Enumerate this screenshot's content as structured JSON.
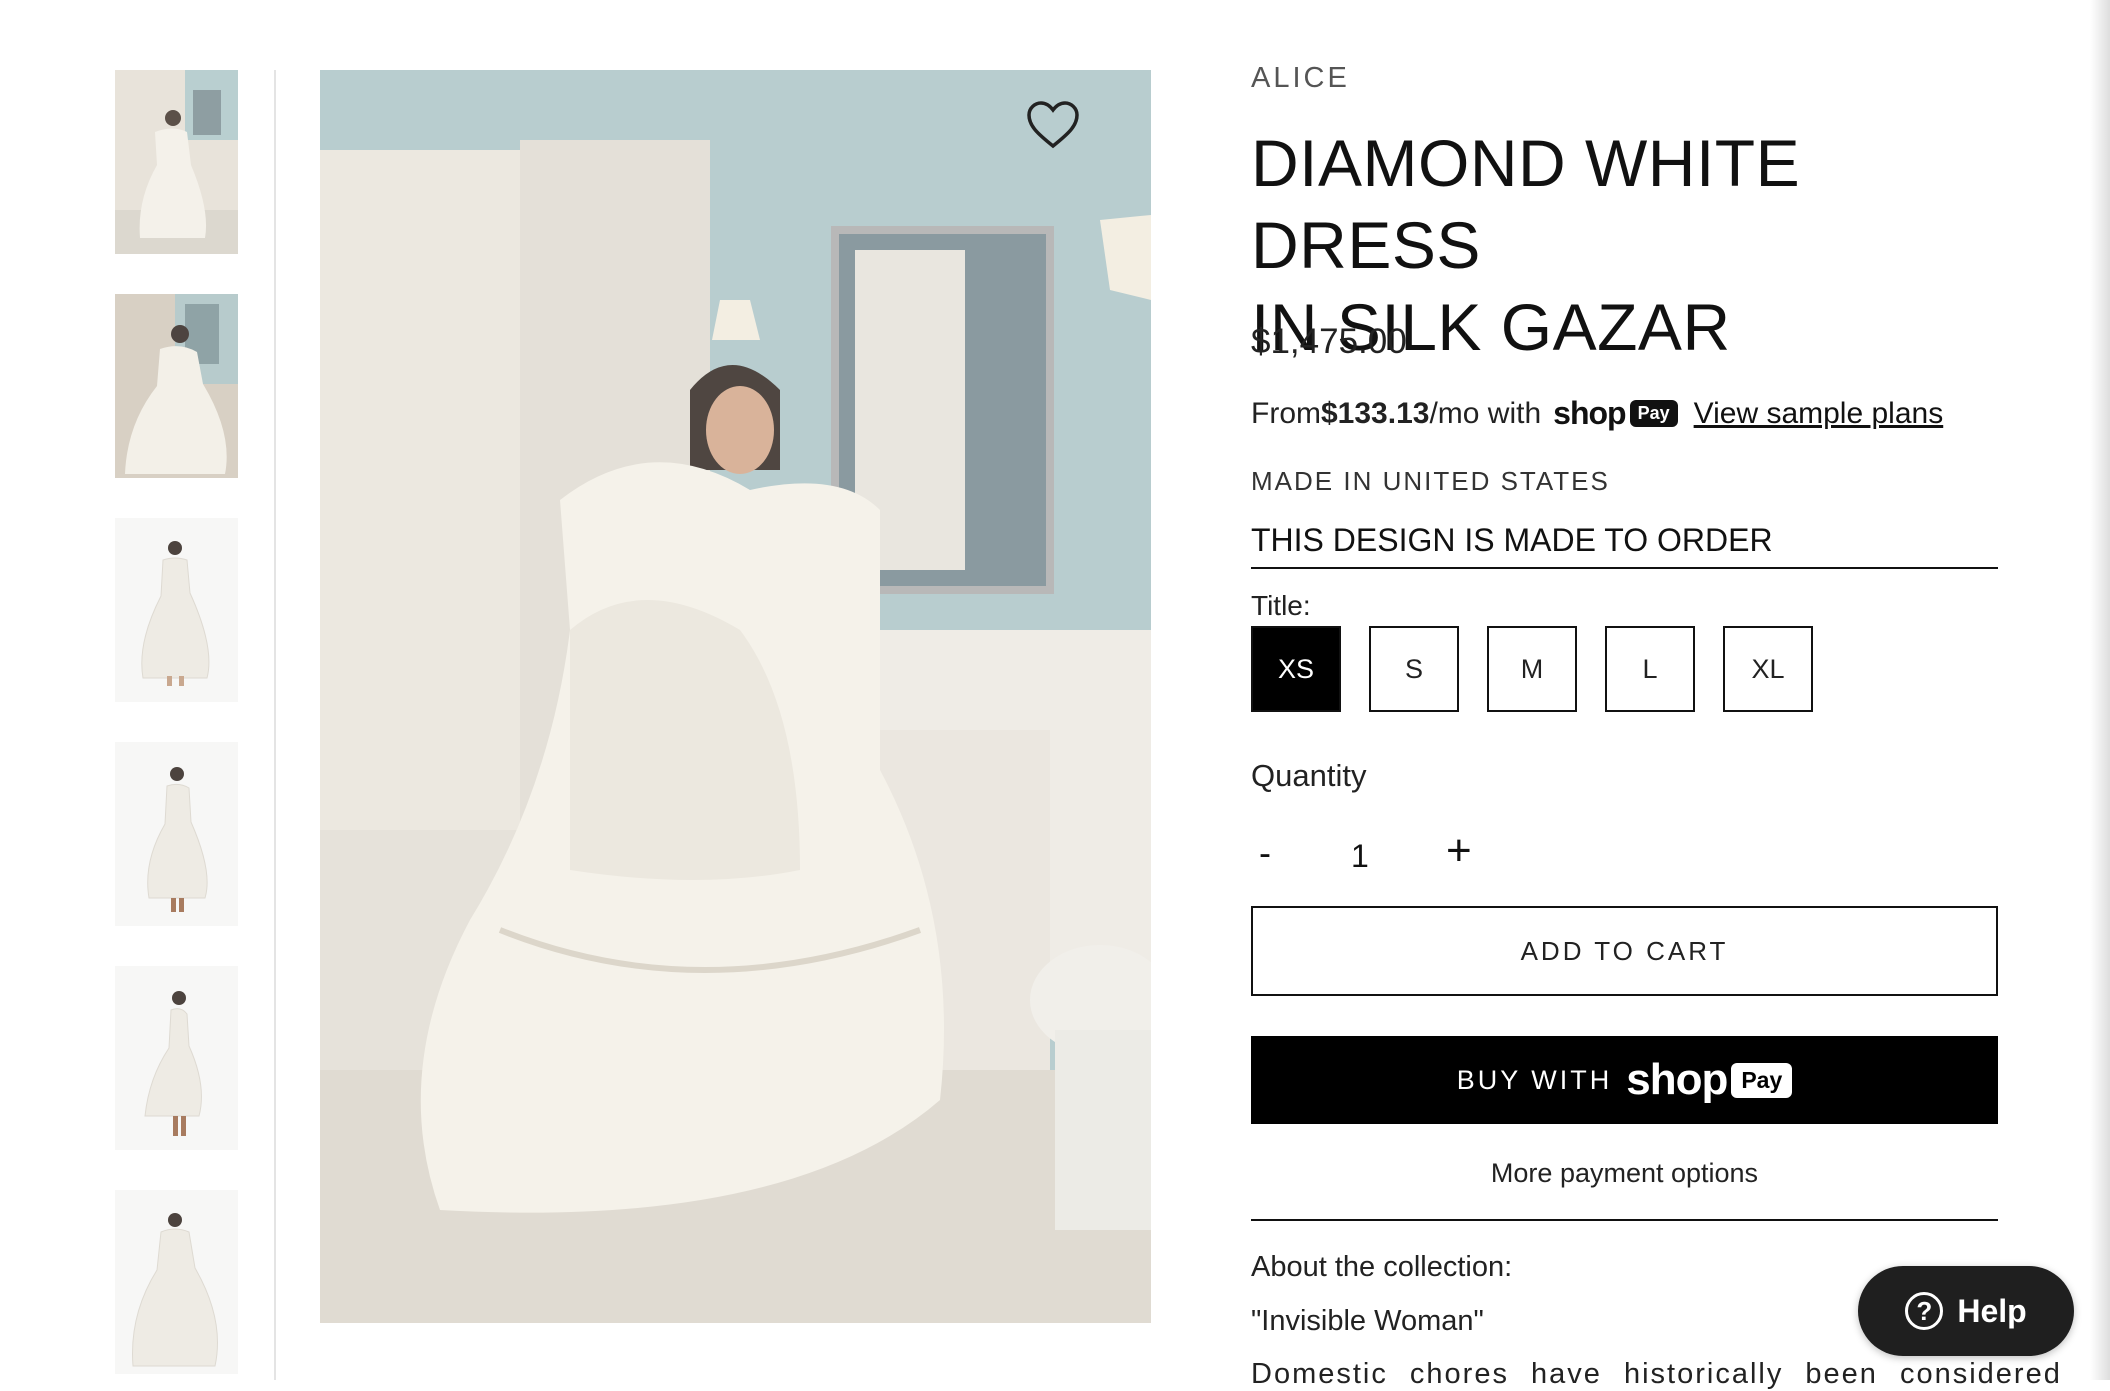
{
  "product": {
    "brand": "ALICE",
    "title_line1": "DIAMOND WHITE DRESS",
    "title_line2": "IN SILK GAZAR",
    "price": "$1,475.00",
    "installment_prefix": "From ",
    "installment_amount": "$133.13",
    "installment_suffix": "/mo with",
    "shop_word": "shop",
    "pay_word": "Pay",
    "sample_plans_link": "View sample plans",
    "made_in": "MADE IN UNITED STATES",
    "made_to_order": "THIS DESIGN IS MADE TO ORDER"
  },
  "options": {
    "label": "Title:",
    "sizes": [
      "XS",
      "S",
      "M",
      "L",
      "XL"
    ],
    "selected": "XS"
  },
  "quantity": {
    "label": "Quantity",
    "minus": "-",
    "value": "1",
    "plus": "+"
  },
  "actions": {
    "add_to_cart": "ADD TO CART",
    "buy_with": "BUY WITH",
    "more_payment": "More payment options"
  },
  "description": {
    "about_label": "About the collection:",
    "quote": "\"Invisible Woman\"",
    "text": "Domestic chores have historically been considered"
  },
  "help": {
    "label": "Help",
    "icon": "question-icon"
  },
  "gallery": {
    "thumbnail_count": 6,
    "favorite_icon": "heart-icon"
  }
}
